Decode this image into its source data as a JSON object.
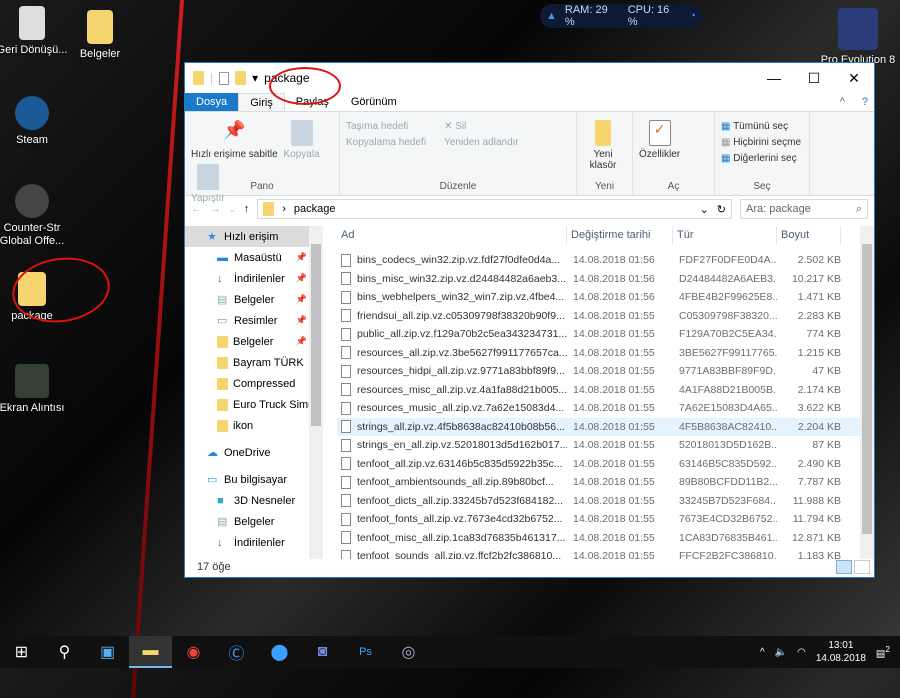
{
  "desktop": {
    "icons": [
      "Geri Dönüşü...",
      "Belgeler",
      "Steam",
      "Counter-Str Global Offe...",
      "package",
      "Ekran Alıntısı",
      "Pro Evolution 8"
    ]
  },
  "widget": {
    "ram": "RAM: 29 %",
    "cpu": "CPU: 16 %"
  },
  "window": {
    "title": "package",
    "controls": {
      "minimize": "—",
      "maximize": "☐",
      "close": "✕"
    }
  },
  "tabs": [
    "Dosya",
    "Giriş",
    "Paylaş",
    "Görünüm"
  ],
  "ribbon": {
    "pano": {
      "label": "Pano",
      "pin": "Hızlı erişime sabitle",
      "copy": "Kopyala",
      "paste": "Yapıştır"
    },
    "duzenle": {
      "label": "Düzenle",
      "move": "Taşıma hedefi",
      "copyto": "Kopyalama hedefi",
      "delete": "Sil",
      "rename": "Yeniden adlandır"
    },
    "yeni": {
      "label": "Yeni",
      "newfolder": "Yeni klasör"
    },
    "ac": {
      "label": "Aç",
      "props": "Özellikler"
    },
    "sec": {
      "label": "Seç",
      "all": "Tümünü seç",
      "none": "Hiçbirini seçme",
      "invert": "Diğerlerini seç"
    }
  },
  "address": {
    "path": "package",
    "search_placeholder": "Ara: package"
  },
  "nav": [
    "Hızlı erişim",
    "Masaüstü",
    "İndirilenler",
    "Belgeler",
    "Resimler",
    "Belgeler",
    "Bayram TÜRK",
    "Compressed",
    "Euro Truck Simu",
    "ikon",
    "OneDrive",
    "Bu bilgisayar",
    "3D Nesneler",
    "Belgeler",
    "İndirilenler"
  ],
  "columns": [
    "Ad",
    "Değiştirme tarihi",
    "Tür",
    "Boyut"
  ],
  "files": [
    [
      "bins_codecs_win32.zip.vz.fdf27f0dfe0d4a...",
      "14.08.2018 01:56",
      "FDF27F0DFE0D4A...",
      "2.502 KB"
    ],
    [
      "bins_misc_win32.zip.vz.d24484482a6aeb3...",
      "14.08.2018 01:56",
      "D24484482A6AEB3...",
      "10.217 KB"
    ],
    [
      "bins_webhelpers_win32_win7.zip.vz.4fbe4...",
      "14.08.2018 01:56",
      "4FBE4B2F99625E8...",
      "1.471 KB"
    ],
    [
      "friendsui_all.zip.vz.c05309798f38320b90f9...",
      "14.08.2018 01:55",
      "C05309798F38320...",
      "2.283 KB"
    ],
    [
      "public_all.zip.vz.f129a70b2c5ea343234731...",
      "14.08.2018 01:55",
      "F129A70B2C5EA34...",
      "774 KB"
    ],
    [
      "resources_all.zip.vz.3be5627f991177657ca...",
      "14.08.2018 01:55",
      "3BE5627F99117765...",
      "1.215 KB"
    ],
    [
      "resources_hidpi_all.zip.vz.9771a83bbf89f9...",
      "14.08.2018 01:55",
      "9771A83BBF89F9D...",
      "47 KB"
    ],
    [
      "resources_misc_all.zip.vz.4a1fa88d21b005...",
      "14.08.2018 01:55",
      "4A1FA88D21B005B...",
      "2.174 KB"
    ],
    [
      "resources_music_all.zip.vz.7a62e15083d4...",
      "14.08.2018 01:55",
      "7A62E15083D4A65...",
      "3.622 KB"
    ],
    [
      "strings_all.zip.vz.4f5b8638ac82410b08b56...",
      "14.08.2018 01:55",
      "4F5B8638AC82410...",
      "2.204 KB"
    ],
    [
      "strings_en_all.zip.vz.52018013d5d162b017...",
      "14.08.2018 01:55",
      "52018013D5D162B...",
      "87 KB"
    ],
    [
      "tenfoot_all.zip.vz.63146b5c835d5922b35c...",
      "14.08.2018 01:55",
      "63146B5C835D592...",
      "2.490 KB"
    ],
    [
      "tenfoot_ambientsounds_all.zip.89b80bcf...",
      "14.08.2018 01:55",
      "89B80BCFDD11B2...",
      "7.787 KB"
    ],
    [
      "tenfoot_dicts_all.zip.33245b7d523f684182...",
      "14.08.2018 01:55",
      "33245B7D523F684...",
      "11.988 KB"
    ],
    [
      "tenfoot_fonts_all.zip.vz.7673e4cd32b6752...",
      "14.08.2018 01:55",
      "7673E4CD32B6752...",
      "11.794 KB"
    ],
    [
      "tenfoot_misc_all.zip.1ca83d76835b461317...",
      "14.08.2018 01:55",
      "1CA83D76835B461...",
      "12.871 KB"
    ],
    [
      "tenfoot_sounds_all.zip.vz.ffcf2b2fc386810...",
      "14.08.2018 01:55",
      "FFCF2B2FC386810...",
      "1.183 KB"
    ]
  ],
  "status": {
    "count": "17 öğe"
  },
  "taskbar": {
    "time": "13:01",
    "date": "14.08.2018",
    "notifications": "2"
  }
}
